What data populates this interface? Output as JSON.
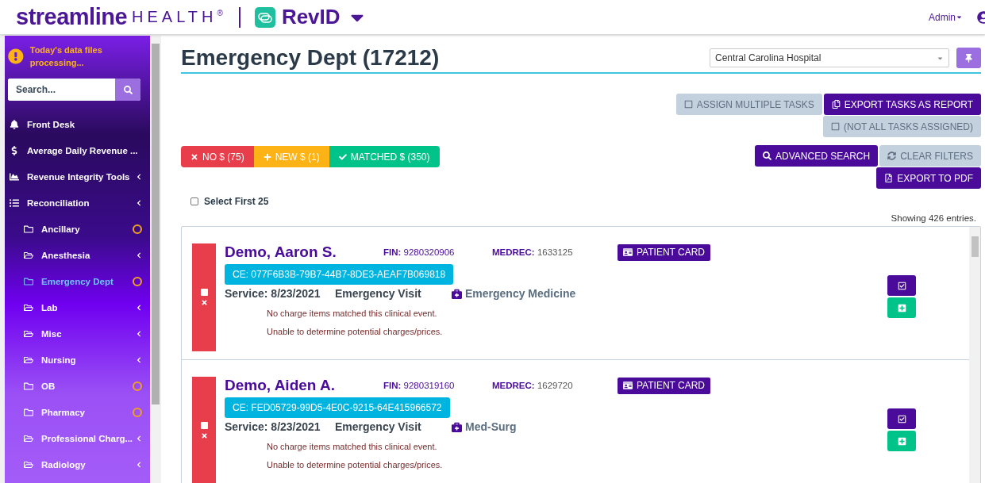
{
  "header": {
    "brand_main": "streamline",
    "brand_sub": "HEALTH",
    "brand_mark": "®",
    "app_name": "RevID",
    "user_menu": "Admin"
  },
  "sidebar": {
    "alert": "Today's data files processing...",
    "search": {
      "placeholder": "Search..."
    },
    "items": [
      {
        "label": "Front Desk",
        "kind": "link",
        "selected": false
      },
      {
        "label": "Average Daily Revenue ...",
        "kind": "link",
        "selected": false
      },
      {
        "label": "Revenue Integrity Tools",
        "kind": "group",
        "selected": false
      },
      {
        "label": "Reconciliation",
        "kind": "group",
        "selected": false,
        "children": [
          {
            "label": "Ancillary",
            "kind": "leaf",
            "processing": true,
            "selected": false
          },
          {
            "label": "Anesthesia",
            "kind": "group",
            "processing": false,
            "selected": false
          },
          {
            "label": "Emergency Dept",
            "kind": "leaf",
            "processing": true,
            "selected": true
          },
          {
            "label": "Lab",
            "kind": "group",
            "processing": false,
            "selected": false
          },
          {
            "label": "Misc",
            "kind": "group",
            "processing": false,
            "selected": false
          },
          {
            "label": "Nursing",
            "kind": "group",
            "processing": false,
            "selected": false
          },
          {
            "label": "OB",
            "kind": "leaf",
            "processing": true,
            "selected": false
          },
          {
            "label": "Pharmacy",
            "kind": "leaf",
            "processing": true,
            "selected": false
          },
          {
            "label": "Professional Charg...",
            "kind": "group",
            "processing": false,
            "selected": false
          },
          {
            "label": "Radiology",
            "kind": "group",
            "processing": false,
            "selected": false
          }
        ]
      }
    ]
  },
  "page": {
    "title": "Emergency Dept (17212)",
    "facility": "Central Carolina Hospital",
    "actions": [
      {
        "label": "ASSIGN MULTIPLE TASKS",
        "disabled": true
      },
      {
        "label": "EXPORT TASKS AS REPORT",
        "disabled": false
      },
      {
        "label": "(NOT ALL TASKS ASSIGNED)",
        "disabled": true
      }
    ],
    "filters": [
      {
        "label": "NO $ (75)",
        "color": "#e83e4c"
      },
      {
        "label": "NEW $ (1)",
        "color": "#fdb316"
      },
      {
        "label": "MATCHED $ (350)",
        "color": "#00c389"
      }
    ],
    "search_actions": [
      {
        "label": "ADVANCED SEARCH",
        "disabled": false
      },
      {
        "label": "CLEAR FILTERS",
        "disabled": true
      },
      {
        "label": "EXPORT TO PDF",
        "disabled": false
      }
    ],
    "select_first": {
      "label": "Select First 25",
      "checked": false
    },
    "count": "Showing 426 entries.",
    "records": [
      {
        "kind": "no_charge",
        "checked": false,
        "name": "Demo, Aaron S.",
        "fin_label": "FIN:",
        "fin": "9280320906",
        "medrec_label": "MEDREC:",
        "medrec": "1633125",
        "card": "PATIENT CARD",
        "ce": "CE: 077F6B3B-79B7-44B7-8DE3-AEAF7B069818",
        "service": "Service: 8/23/2021",
        "visit": "Emergency Visit",
        "department": "Emergency Medicine",
        "messages": [
          "No charge items matched this clinical event.",
          "Unable to determine potential charges/prices."
        ]
      },
      {
        "kind": "no_charge",
        "checked": false,
        "name": "Demo, Aiden A.",
        "fin_label": "FIN:",
        "fin": "9280319160",
        "medrec_label": "MEDREC:",
        "medrec": "1629720",
        "card": "PATIENT CARD",
        "ce": "CE: FED05729-99D5-4E0C-9215-64E415966572",
        "service": "Service: 8/23/2021",
        "visit": "Emergency Visit",
        "department": "Med-Surg",
        "messages": [
          "No charge items matched this clinical event.",
          "Unable to determine potential charges/prices."
        ]
      }
    ]
  }
}
